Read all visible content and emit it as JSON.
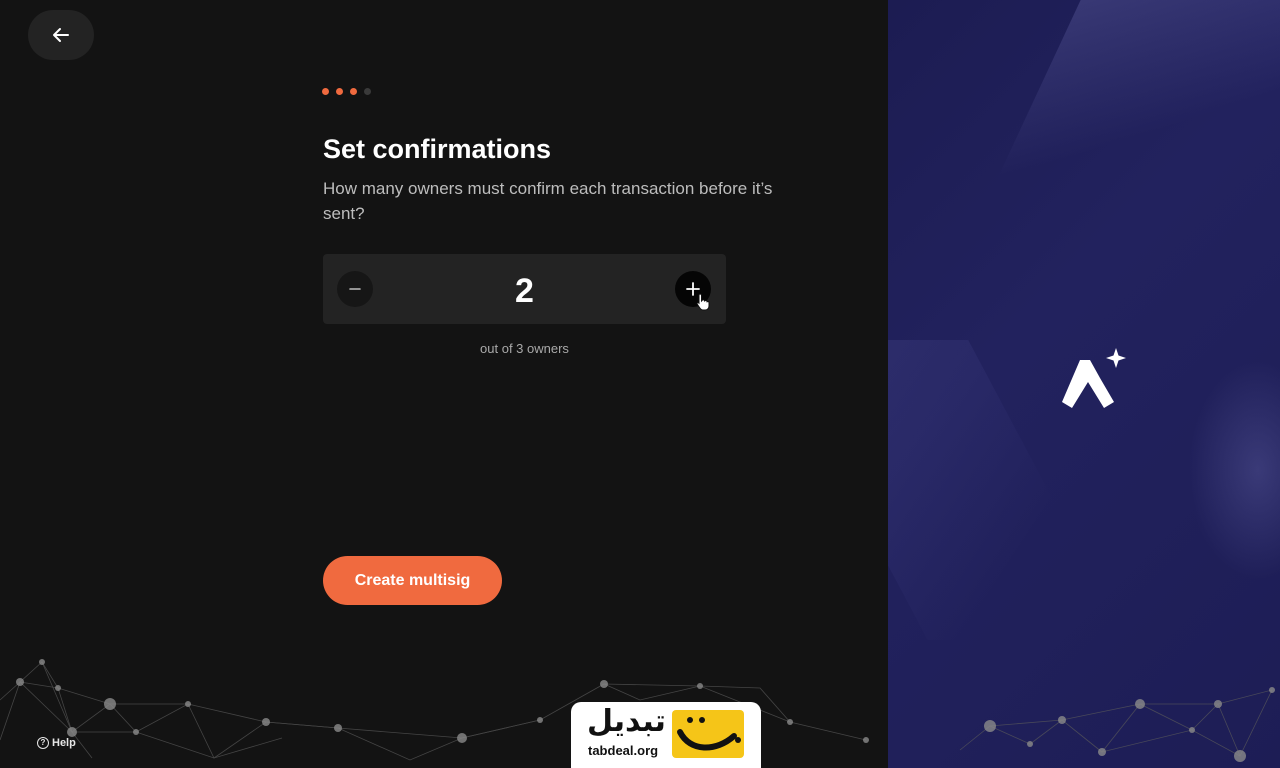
{
  "header": {
    "back_icon": "arrow-left-icon"
  },
  "progress": {
    "steps_total": 4,
    "steps_completed": 3,
    "active_color": "#f06a3f",
    "inactive_color": "#3a3a3a"
  },
  "content": {
    "title": "Set confirmations",
    "subtitle": "How many owners must confirm each transaction before it’s sent?"
  },
  "stepper": {
    "value": "2",
    "decrement_icon": "minus-icon",
    "increment_icon": "plus-icon",
    "caption": "out of 3 owners"
  },
  "actions": {
    "create_label": "Create multisig"
  },
  "footer": {
    "help_label": "Help",
    "help_icon": "question-circle-icon"
  },
  "watermark": {
    "fa_text": "تبدیل",
    "en_text": "tabdeal.org"
  },
  "brand": {
    "logo_icon": "sparkle-logo-icon"
  },
  "colors": {
    "accent": "#f06a3f",
    "background": "#131313",
    "panel": "#232323",
    "right_panel": "#1f1f5a"
  }
}
